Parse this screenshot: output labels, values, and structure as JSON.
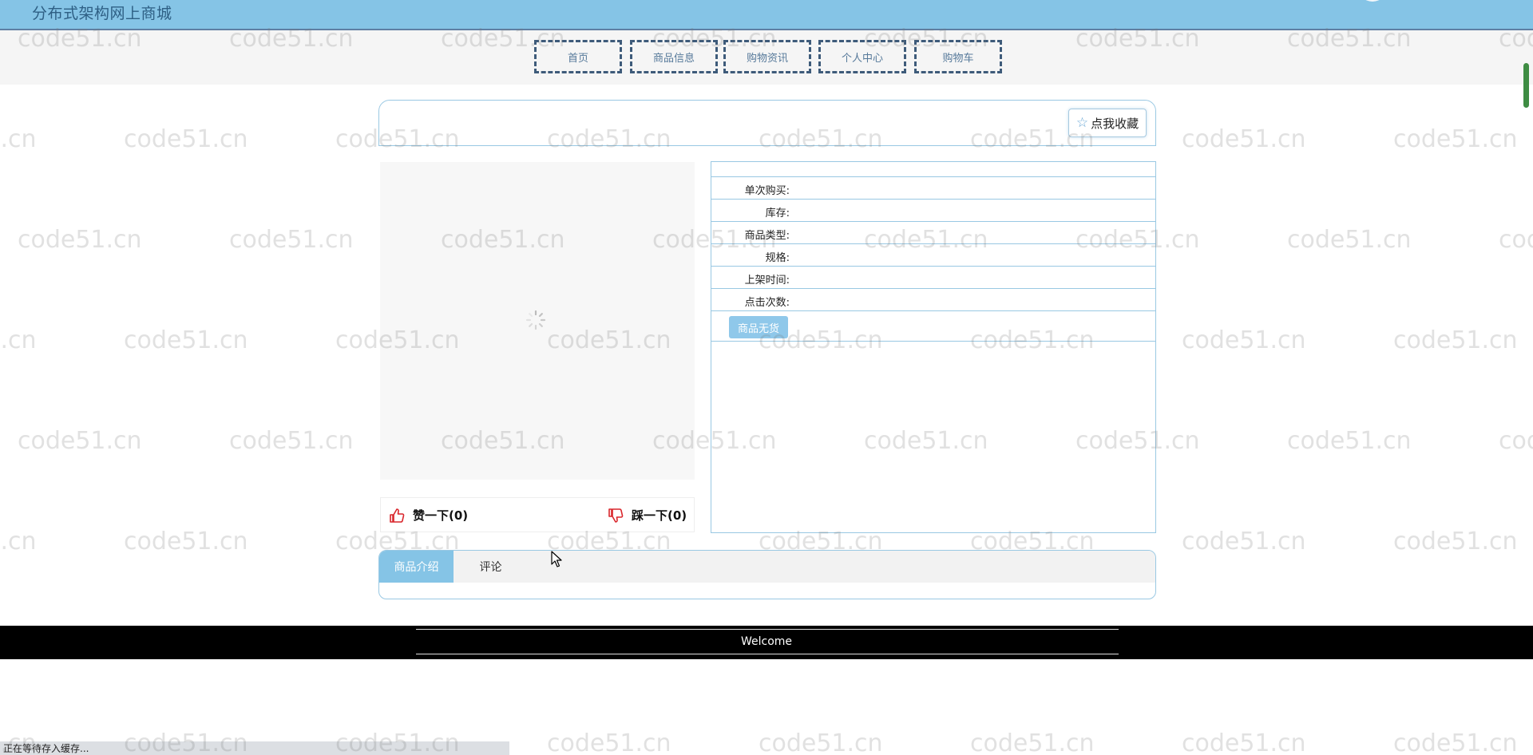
{
  "header": {
    "site_title": "分布式架构网上商城"
  },
  "nav": {
    "items": [
      {
        "label": "首页"
      },
      {
        "label": "商品信息"
      },
      {
        "label": "购物资讯"
      },
      {
        "label": "个人中心"
      },
      {
        "label": "购物车"
      }
    ]
  },
  "product": {
    "favorite_label": "点我收藏",
    "like_label": "赞一下(0)",
    "dislike_label": "踩一下(0)",
    "info_rows": [
      {
        "label": "单次购买:",
        "value": ""
      },
      {
        "label": "库存:",
        "value": ""
      },
      {
        "label": "商品类型:",
        "value": ""
      },
      {
        "label": "规格:",
        "value": ""
      },
      {
        "label": "上架时间:",
        "value": ""
      },
      {
        "label": "点击次数:",
        "value": ""
      }
    ],
    "out_of_stock_label": "商品无货"
  },
  "tabs": [
    {
      "label": "商品介绍",
      "active": true
    },
    {
      "label": "评论",
      "active": false
    }
  ],
  "footer": {
    "text": "Welcome"
  },
  "status": {
    "text": "正在等待存入缓存..."
  },
  "watermark": {
    "text": "code51.cn"
  },
  "colors": {
    "header_bg": "#85c4e6",
    "nav_border": "#3e5b7a",
    "panel_border": "#99c8e3",
    "active_tab": "#85c4e6",
    "like_icon": "#d9262c",
    "footer_bg": "#000000"
  },
  "icons": {
    "favorite": "star-icon",
    "like": "thumbs-up-icon",
    "dislike": "thumbs-down-icon",
    "loading": "spinner-icon"
  }
}
